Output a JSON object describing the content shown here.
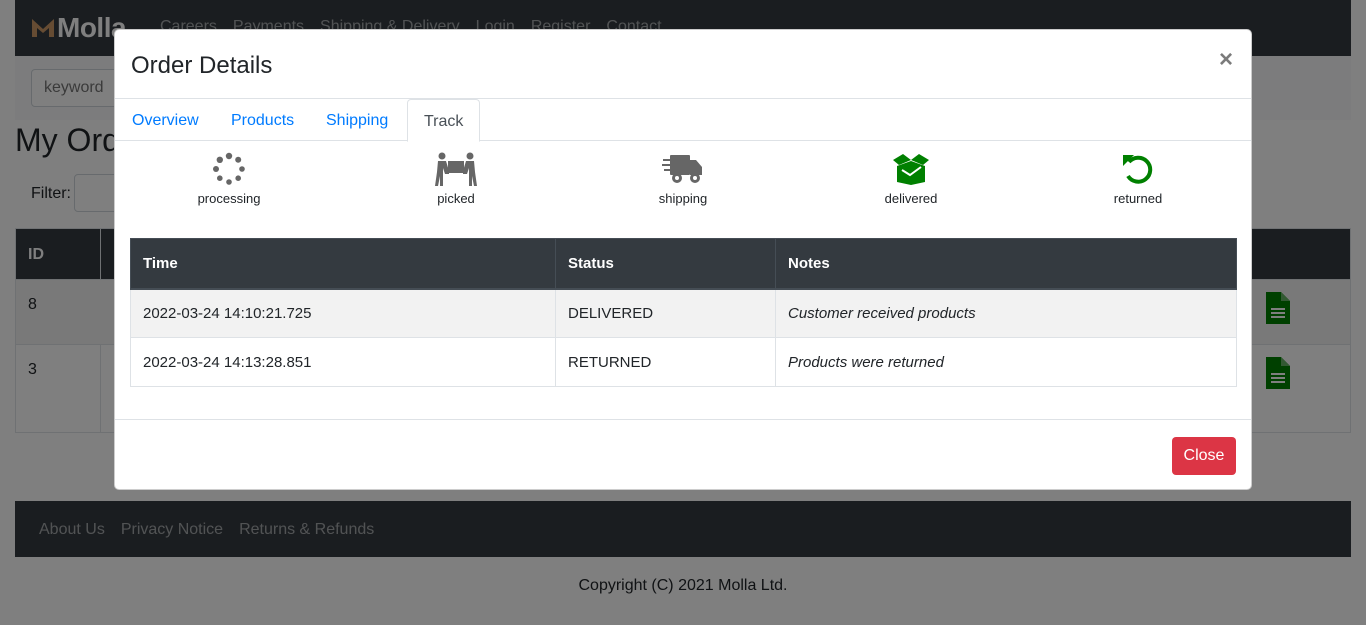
{
  "brand": {
    "name": "Molla"
  },
  "nav": {
    "items": [
      "Careers",
      "Payments",
      "Shipping & Delivery",
      "Login",
      "Register",
      "Contact"
    ]
  },
  "search": {
    "placeholder": "keyword"
  },
  "page": {
    "title": "My Orders",
    "filter_label": "Filter:"
  },
  "orders_table": {
    "header_first": "ID",
    "rows": [
      {
        "id": "8"
      },
      {
        "id": "3"
      }
    ]
  },
  "footer": {
    "links": [
      "About Us",
      "Privacy Notice",
      "Returns & Refunds"
    ],
    "copyright": "Copyright (C) 2021 Molla Ltd."
  },
  "modal": {
    "title": "Order Details",
    "close_symbol": "×",
    "tabs": [
      {
        "label": "Overview",
        "active": false
      },
      {
        "label": "Products",
        "active": false
      },
      {
        "label": "Shipping",
        "active": false
      },
      {
        "label": "Track",
        "active": true
      }
    ],
    "track_steps": [
      {
        "label": "processing",
        "icon": "spinner-icon",
        "color": "#666666"
      },
      {
        "label": "picked",
        "icon": "people-carry-icon",
        "color": "#666666"
      },
      {
        "label": "shipping",
        "icon": "shipping-fast-icon",
        "color": "#666666"
      },
      {
        "label": "delivered",
        "icon": "box-open-icon",
        "color": "#008000"
      },
      {
        "label": "returned",
        "icon": "undo-icon",
        "color": "#008000"
      }
    ],
    "track_table": {
      "headers": [
        "Time",
        "Status",
        "Notes"
      ],
      "rows": [
        {
          "time": "2022-03-24 14:10:21.725",
          "status": "DELIVERED",
          "notes": "Customer received products"
        },
        {
          "time": "2022-03-24 14:13:28.851",
          "status": "RETURNED",
          "notes": "Products were returned"
        }
      ]
    },
    "close_button": "Close"
  },
  "colors": {
    "navbar": "#343a40",
    "link": "#007bff",
    "danger": "#dc3545",
    "active_icon": "#008000",
    "inactive_icon": "#666666"
  }
}
